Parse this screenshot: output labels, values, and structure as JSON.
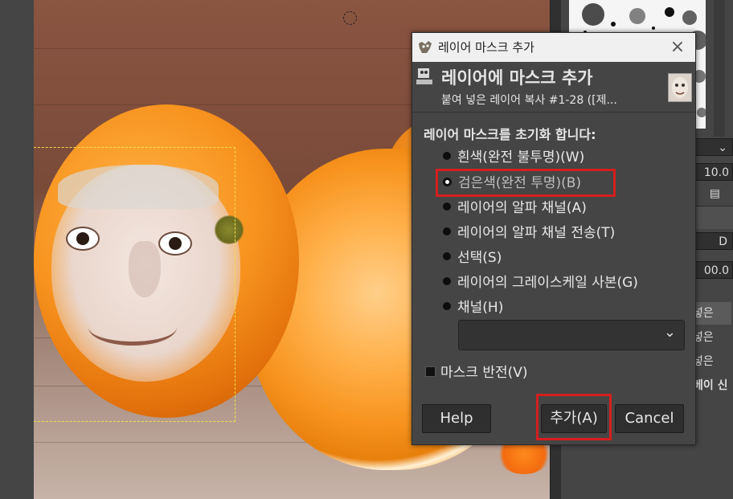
{
  "dialog": {
    "window_title": "레이어 마스크 추가",
    "header_title": "레이어에 마스크 추가",
    "header_subtitle": "붙여 넣은 레이어 복사 #1-28 ([제...",
    "section_label": "레이어 마스크를 초기화 합니다:",
    "options": [
      {
        "label": "흰색(완전 불투명)(W)",
        "selected": false
      },
      {
        "label": "검은색(완전 투명)(B)",
        "selected": true
      },
      {
        "label": "레이어의 알파 채널(A)",
        "selected": false
      },
      {
        "label": "레이어의 알파 채널 전송(T)",
        "selected": false
      },
      {
        "label": "선택(S)",
        "selected": false
      },
      {
        "label": "레이어의 그레이스케일 사본(G)",
        "selected": false
      },
      {
        "label": "채널(H)",
        "selected": false
      }
    ],
    "channel_value": "",
    "invert_label": "마스크 반전(V)",
    "invert_checked": false,
    "buttons": {
      "help": "Help",
      "add": "추가(A)",
      "cancel": "Cancel"
    },
    "close_glyph": "×"
  },
  "dock": {
    "field_1": "10.0",
    "field_2": "00.0",
    "layer_items": [
      "넣은",
      "넣은",
      "넣은",
      "베이 신"
    ]
  },
  "colors": {
    "dialog_bg": "#454545",
    "highlight": "#d61e1e",
    "selection": "#f1e04a"
  }
}
